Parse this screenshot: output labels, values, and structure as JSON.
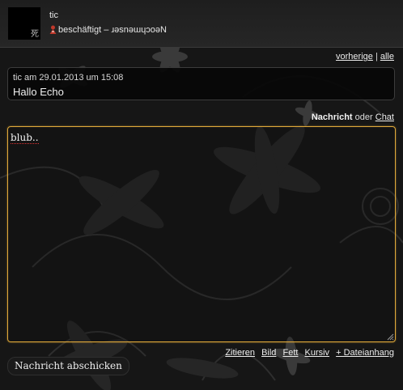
{
  "header": {
    "avatar_glyph": "死",
    "username": "tic",
    "status": "beschäftigt",
    "status_separator": "–",
    "status_message": "ɹǝsnǝɯɥɔoǝN"
  },
  "nav": {
    "prev_label": "vorherige",
    "separator": "|",
    "all_label": "alle"
  },
  "message": {
    "meta": "tic am 29.01.2013 um 15:08",
    "text": "Hallo Echo"
  },
  "mode": {
    "active": "Nachricht",
    "or": "oder",
    "chat_label": "Chat"
  },
  "editor": {
    "value": "blub.."
  },
  "format_links": {
    "quote": "Zitieren",
    "image": "Bild",
    "bold": "Fett",
    "italic": "Kursiv",
    "attachment": "+ Dateianhang"
  },
  "send_button": {
    "label": "Nachricht abschicken"
  },
  "colors": {
    "accent": "#e0a93a",
    "background": "#161616",
    "status_icon": "#c0392b"
  }
}
